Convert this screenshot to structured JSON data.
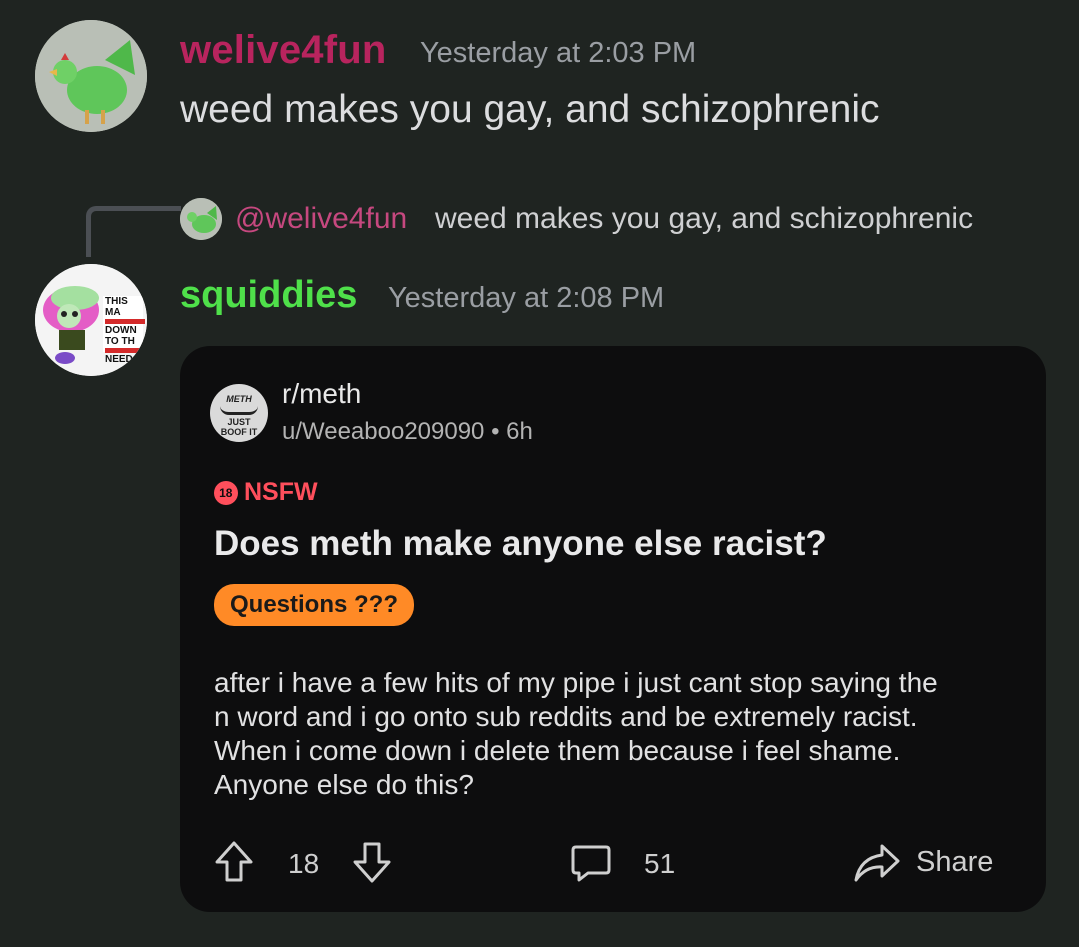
{
  "message1": {
    "username": "welive4fun",
    "timestamp": "Yesterday at 2:03 PM",
    "text": "weed makes you gay, and schizophrenic"
  },
  "reply": {
    "mention": "@welive4fun",
    "text": "weed makes you gay, and schizophrenic"
  },
  "message2": {
    "username": "squiddies",
    "timestamp": "Yesterday at 2:08 PM",
    "avatar_text": [
      "THIS MA",
      "DOWN",
      "TO TH",
      "NEED"
    ]
  },
  "post": {
    "subreddit": "r/meth",
    "author_meta": "u/Weeaboo209090 • 6h",
    "subreddit_icon_text": [
      "METH",
      "JUST",
      "BOOF IT"
    ],
    "nsfw_badge": "18",
    "nsfw_label": "NSFW",
    "title": "Does meth make anyone else racist?",
    "flair": "Questions ???",
    "body_lines": [
      "after i have a few hits of my pipe i just cant stop saying the",
      "n word and i go onto sub reddits and be extremely racist.",
      "When i come down i delete them because i feel shame.",
      "Anyone else do this?"
    ],
    "upvotes": "18",
    "comments": "51",
    "share_label": "Share",
    "colors": {
      "flair": "#ff8a26",
      "nsfw": "#ff4f5c"
    }
  },
  "colors": {
    "background": "#1f2421",
    "username1": "#b8245e",
    "username2": "#4fe04a",
    "mention": "#c6487f"
  }
}
